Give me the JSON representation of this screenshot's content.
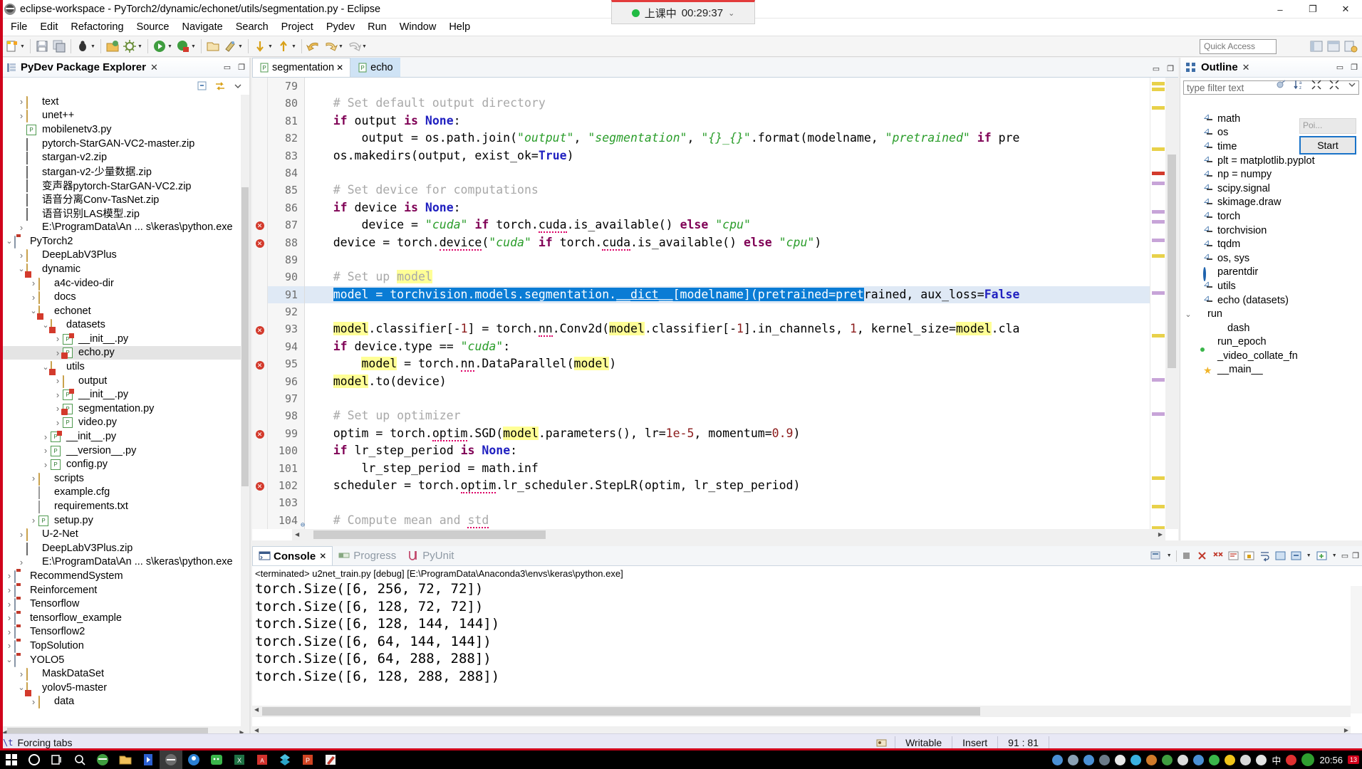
{
  "window": {
    "title": "eclipse-workspace - PyTorch2/dynamic/echonet/utils/segmentation.py - Eclipse",
    "minimize": "–",
    "maximize": "❐",
    "close": "✕"
  },
  "timer": {
    "label": "上课中",
    "time": "00:29:37",
    "caret": "⌄"
  },
  "menubar": {
    "items": [
      "File",
      "Edit",
      "Refactoring",
      "Source",
      "Navigate",
      "Search",
      "Project",
      "Pydev",
      "Run",
      "Window",
      "Help"
    ]
  },
  "toolbar": {
    "quick_access_placeholder": "Quick Access",
    "icons": [
      "new-wizard-icon",
      "save-icon",
      "save-all-icon",
      "debug-icon",
      "external-tools-icon",
      "build-icon",
      "run-icon",
      "coverage-icon",
      "open-type-icon",
      "search-icon",
      "next-annotation-icon",
      "previous-annotation-icon",
      "back-icon",
      "forward-icon",
      "undo-icon"
    ],
    "right_icons": [
      "perspective-java-icon",
      "perspective-pydev-icon",
      "open-perspective-icon"
    ]
  },
  "explorer": {
    "title": "PyDev Package Explorer",
    "close_glyph": "✕",
    "minimize_glyph": "▭",
    "maximize_glyph": "❐",
    "toolbar_icons": [
      "collapse-all-icon",
      "link-with-editor-icon",
      "view-menu-icon"
    ],
    "tree": [
      {
        "indent": 1,
        "expander": ">",
        "icon": "folder-icon",
        "label": "text"
      },
      {
        "indent": 1,
        "expander": ">",
        "icon": "folder-icon",
        "label": "unet++"
      },
      {
        "indent": 1,
        "expander": "",
        "icon": "python-file-icon",
        "label": "mobilenetv3.py"
      },
      {
        "indent": 1,
        "expander": "",
        "icon": "zip-icon",
        "label": "pytorch-StarGAN-VC2-master.zip"
      },
      {
        "indent": 1,
        "expander": "",
        "icon": "zip-icon",
        "label": "stargan-v2.zip"
      },
      {
        "indent": 1,
        "expander": "",
        "icon": "zip-icon",
        "label": "stargan-v2-少量数据.zip"
      },
      {
        "indent": 1,
        "expander": "",
        "icon": "zip-icon",
        "label": "变声器pytorch-StarGAN-VC2.zip"
      },
      {
        "indent": 1,
        "expander": "",
        "icon": "zip-icon",
        "label": "语音分离Conv-TasNet.zip"
      },
      {
        "indent": 1,
        "expander": "",
        "icon": "zip-icon",
        "label": "语音识别LAS模型.zip"
      },
      {
        "indent": 1,
        "expander": ">",
        "icon": "python-interpreter-icon",
        "label": "E:\\ProgramData\\An ... s\\keras\\python.exe"
      },
      {
        "indent": 0,
        "expander": "v",
        "icon": "project-icon",
        "label": "PyTorch2"
      },
      {
        "indent": 1,
        "expander": ">",
        "icon": "folder-icon",
        "label": "DeepLabV3Plus"
      },
      {
        "indent": 1,
        "expander": "v",
        "icon": "package-icon",
        "label": "dynamic"
      },
      {
        "indent": 2,
        "expander": ">",
        "icon": "folder-icon",
        "label": "a4c-video-dir"
      },
      {
        "indent": 2,
        "expander": ">",
        "icon": "folder-icon",
        "label": "docs"
      },
      {
        "indent": 2,
        "expander": "v",
        "icon": "package-icon",
        "label": "echonet"
      },
      {
        "indent": 3,
        "expander": "v",
        "icon": "package-icon",
        "label": "datasets"
      },
      {
        "indent": 4,
        "expander": ">",
        "icon": "init-file-icon",
        "label": "__init__.py"
      },
      {
        "indent": 4,
        "expander": ">",
        "icon": "python-error-file-icon",
        "label": "echo.py",
        "selected": true
      },
      {
        "indent": 3,
        "expander": "v",
        "icon": "package-icon",
        "label": "utils"
      },
      {
        "indent": 4,
        "expander": ">",
        "icon": "folder-icon",
        "label": "output"
      },
      {
        "indent": 4,
        "expander": ">",
        "icon": "init-file-icon",
        "label": "__init__.py"
      },
      {
        "indent": 4,
        "expander": ">",
        "icon": "python-error-file-icon",
        "label": "segmentation.py"
      },
      {
        "indent": 4,
        "expander": ">",
        "icon": "python-file-icon",
        "label": "video.py"
      },
      {
        "indent": 3,
        "expander": ">",
        "icon": "init-file-icon",
        "label": "__init__.py"
      },
      {
        "indent": 3,
        "expander": ">",
        "icon": "python-file-icon",
        "label": "__version__.py"
      },
      {
        "indent": 3,
        "expander": ">",
        "icon": "python-file-icon",
        "label": "config.py"
      },
      {
        "indent": 2,
        "expander": ">",
        "icon": "folder-icon",
        "label": "scripts"
      },
      {
        "indent": 2,
        "expander": "",
        "icon": "text-file-icon",
        "label": "example.cfg"
      },
      {
        "indent": 2,
        "expander": "",
        "icon": "text-file-icon",
        "label": "requirements.txt"
      },
      {
        "indent": 2,
        "expander": ">",
        "icon": "python-file-icon",
        "label": "setup.py"
      },
      {
        "indent": 1,
        "expander": ">",
        "icon": "folder-icon",
        "label": "U-2-Net"
      },
      {
        "indent": 1,
        "expander": "",
        "icon": "zip-icon",
        "label": "DeepLabV3Plus.zip"
      },
      {
        "indent": 1,
        "expander": ">",
        "icon": "python-interpreter-icon",
        "label": "E:\\ProgramData\\An ... s\\keras\\python.exe"
      },
      {
        "indent": 0,
        "expander": ">",
        "icon": "project-icon",
        "label": "RecommendSystem"
      },
      {
        "indent": 0,
        "expander": ">",
        "icon": "project-icon",
        "label": "Reinforcement"
      },
      {
        "indent": 0,
        "expander": ">",
        "icon": "project-icon",
        "label": "Tensorflow"
      },
      {
        "indent": 0,
        "expander": ">",
        "icon": "project-icon",
        "label": "tensorflow_example"
      },
      {
        "indent": 0,
        "expander": ">",
        "icon": "project-icon",
        "label": "Tensorflow2"
      },
      {
        "indent": 0,
        "expander": ">",
        "icon": "project-icon",
        "label": "TopSolution"
      },
      {
        "indent": 0,
        "expander": "v",
        "icon": "project-icon",
        "label": "YOLO5"
      },
      {
        "indent": 1,
        "expander": ">",
        "icon": "folder-icon",
        "label": "MaskDataSet"
      },
      {
        "indent": 1,
        "expander": "v",
        "icon": "package-icon",
        "label": "yolov5-master"
      },
      {
        "indent": 2,
        "expander": ">",
        "icon": "folder-icon",
        "label": "data"
      }
    ]
  },
  "editor": {
    "tabs": [
      {
        "label": "segmentation",
        "active": true,
        "close_glyph": "✕",
        "icon": "python-file-icon"
      },
      {
        "label": "echo",
        "active": false,
        "close_glyph": "",
        "icon": "python-file-icon"
      }
    ],
    "controls": [
      "minimize-icon",
      "maximize-icon"
    ],
    "lines": [
      {
        "n": "79",
        "err": false,
        "html": ""
      },
      {
        "n": "80",
        "err": false,
        "html": "<span class='cmt'>    # Set default output directory</span>"
      },
      {
        "n": "81",
        "err": false,
        "html": "    <span class='kw'>if</span> output <span class='kw'>is</span> <span class='kw2'>None</span>:"
      },
      {
        "n": "82",
        "err": false,
        "html": "        output = os.path.join(<span class='str'>\"output\"</span>, <span class='str'>\"segmentation\"</span>, <span class='str'>\"{}_{}\"</span>.format(modelname, <span class='str'>\"pretrained\"</span> <span class='kw'>if</span> pre"
      },
      {
        "n": "83",
        "err": false,
        "html": "    os.makedirs(output, exist_ok=<span class='kw2'>True</span>)"
      },
      {
        "n": "84",
        "err": false,
        "html": ""
      },
      {
        "n": "85",
        "err": false,
        "html": "<span class='cmt'>    # Set device for computations</span>"
      },
      {
        "n": "86",
        "err": false,
        "html": "    <span class='kw'>if</span> device <span class='kw'>is</span> <span class='kw2'>None</span>:"
      },
      {
        "n": "87",
        "err": true,
        "html": "        device = <span class='str'>\"cuda\"</span> <span class='kw'>if</span> torch.<span class='sq'>cuda</span>.is_available() <span class='kw'>else</span> <span class='str'>\"cpu\"</span>"
      },
      {
        "n": "88",
        "err": true,
        "html": "    device = torch.<span class='sq'>device</span>(<span class='str'>\"cuda\"</span> <span class='kw'>if</span> torch.<span class='sq'>cuda</span>.is_available() <span class='kw'>else</span> <span class='str'>\"cpu\"</span>)"
      },
      {
        "n": "89",
        "err": false,
        "html": ""
      },
      {
        "n": "90",
        "err": false,
        "html": "<span class='cmt'>    # Set up <span class='hl'>model</span></span>"
      },
      {
        "n": "91",
        "err": false,
        "selected": true,
        "html": "    <span class='selcode'>model = torchvision.models.segmentation.<span class='ul'>__dict__</span>[modelname](pretrained=pret</span>rained, aux_loss=<span class='kw2'>False</span>"
      },
      {
        "n": "92",
        "err": false,
        "html": ""
      },
      {
        "n": "93",
        "err": true,
        "html": "    <span class='hl'>model</span>.classifier[-<span class='num'>1</span>] = torch.<span class='sq'>nn</span>.Conv2d(<span class='hl'>model</span>.classifier[-<span class='num'>1</span>].in_channels, <span class='num'>1</span>, kernel_size=<span class='hl'>model</span>.cla"
      },
      {
        "n": "94",
        "err": false,
        "html": "    <span class='kw'>if</span> device.type == <span class='str'>\"cuda\"</span>:"
      },
      {
        "n": "95",
        "err": true,
        "html": "        <span class='hl'>model</span> = torch.<span class='sq'>nn</span>.DataParallel(<span class='hl'>model</span>)"
      },
      {
        "n": "96",
        "err": false,
        "html": "    <span class='hl'>model</span>.to(device)"
      },
      {
        "n": "97",
        "err": false,
        "html": ""
      },
      {
        "n": "98",
        "err": false,
        "html": "<span class='cmt'>    # Set up optimizer</span>"
      },
      {
        "n": "99",
        "err": true,
        "html": "    optim = torch.<span class='sq'>optim</span>.SGD(<span class='hl'>model</span>.parameters(), lr=<span class='num'>1e-5</span>, momentum=<span class='num'>0.9</span>)"
      },
      {
        "n": "100",
        "err": false,
        "html": "    <span class='kw'>if</span> lr_step_period <span class='kw'>is</span> <span class='kw2'>None</span>:"
      },
      {
        "n": "101",
        "err": false,
        "html": "        lr_step_period = math.inf"
      },
      {
        "n": "102",
        "err": true,
        "html": "    scheduler = torch.<span class='sq'>optim</span>.lr_scheduler.StepLR(optim, lr_step_period)"
      },
      {
        "n": "103",
        "err": false,
        "html": ""
      },
      {
        "n": "104",
        "err": false,
        "fold": true,
        "html": "<span class='cmt'>    # Compute mean and <span class='sq'>std</span></span>"
      }
    ]
  },
  "outline": {
    "title": "Outline",
    "close_glyph": "✕",
    "minimize_glyph": "▭",
    "maximize_glyph": "❐",
    "filter_placeholder": "type filter text",
    "toolbar_icons": [
      "link-icon",
      "sort-icon",
      "collapse-all-icon",
      "expand-all-icon",
      "view-menu-icon"
    ],
    "items": [
      {
        "indent": 1,
        "expander": "",
        "icon": "import-icon",
        "label": "math"
      },
      {
        "indent": 1,
        "expander": "",
        "icon": "import-icon",
        "label": "os"
      },
      {
        "indent": 1,
        "expander": "",
        "icon": "import-icon",
        "label": "time"
      },
      {
        "indent": 1,
        "expander": "",
        "icon": "import-icon",
        "label": "plt = matplotlib.pyplot"
      },
      {
        "indent": 1,
        "expander": "",
        "icon": "import-icon",
        "label": "np = numpy"
      },
      {
        "indent": 1,
        "expander": "",
        "icon": "import-icon",
        "label": "scipy.signal"
      },
      {
        "indent": 1,
        "expander": "",
        "icon": "import-icon",
        "label": "skimage.draw"
      },
      {
        "indent": 1,
        "expander": "",
        "icon": "import-icon",
        "label": "torch"
      },
      {
        "indent": 1,
        "expander": "",
        "icon": "import-icon",
        "label": "torchvision"
      },
      {
        "indent": 1,
        "expander": "",
        "icon": "import-icon",
        "label": "tqdm"
      },
      {
        "indent": 1,
        "expander": "",
        "icon": "import-icon",
        "label": "os, sys"
      },
      {
        "indent": 1,
        "expander": "",
        "icon": "variable-icon",
        "label": "parentdir"
      },
      {
        "indent": 1,
        "expander": "",
        "icon": "import-icon",
        "label": "utils"
      },
      {
        "indent": 1,
        "expander": "",
        "icon": "import-icon",
        "label": "echo (datasets)"
      },
      {
        "indent": 0,
        "expander": "v",
        "icon": "method-icon",
        "label": "run"
      },
      {
        "indent": 2,
        "expander": "",
        "icon": "method-icon",
        "label": "dash"
      },
      {
        "indent": 1,
        "expander": "",
        "icon": "method-icon",
        "label": "run_epoch"
      },
      {
        "indent": 1,
        "expander": "",
        "icon": "method-private-icon",
        "label": "_video_collate_fn"
      },
      {
        "indent": 1,
        "expander": "",
        "icon": "main-icon",
        "label": "__main__"
      }
    ],
    "popup": {
      "field_text": "Poi...",
      "button_label": "Start"
    }
  },
  "console": {
    "tabs": [
      {
        "label": "Console",
        "active": true,
        "close_glyph": "✕",
        "icon": "console-icon"
      },
      {
        "label": "Progress",
        "active": false,
        "icon": "progress-icon"
      },
      {
        "label": "PyUnit",
        "active": false,
        "icon": "pyunit-icon"
      }
    ],
    "toolbar_icons": [
      "display-selected-console-icon",
      "terminate-icon",
      "remove-launch-icon",
      "remove-all-icon",
      "clear-icon",
      "scroll-lock-icon",
      "word-wrap-icon",
      "pin-console-icon",
      "open-console-icon",
      "new-console-view-icon",
      "minimize-icon",
      "maximize-icon"
    ],
    "launch_line": "<terminated> u2net_train.py [debug] [E:\\ProgramData\\Anaconda3\\envs\\keras\\python.exe]",
    "output": [
      "torch.Size([6, 256, 72, 72])",
      "torch.Size([6, 128, 72, 72])",
      "torch.Size([6, 128, 144, 144])",
      "torch.Size([6, 64, 144, 144])",
      "torch.Size([6, 64, 288, 288])",
      "torch.Size([6, 128, 288, 288])"
    ],
    "prompt": ">>>"
  },
  "statusbar": {
    "vt_glyph": "\\t",
    "message": "Forcing tabs",
    "smart_insert_icon": "smart-insert-icon",
    "writable": "Writable",
    "insert": "Insert",
    "position": "91 : 81"
  },
  "taskbar": {
    "start_icon": "windows-start-icon",
    "left_icons": [
      "cortana-icon",
      "task-view-icon",
      "search-icon",
      "eclipse-icon",
      "file-explorer-icon",
      "editor-icon",
      "eclipse-active-icon",
      "browser-icon",
      "wechat-icon",
      "excel-icon",
      "pdf-icon",
      "sublime-icon",
      "powerpoint-icon",
      "paint-icon"
    ],
    "tray_icons": [
      "shield-icon",
      "network-icon",
      "security-icon",
      "settings-icon",
      "bell-icon",
      "sync-icon",
      "snail-icon",
      "eclipse-tray-icon",
      "usb-icon",
      "box-icon",
      "green-shield-icon",
      "plus-icon",
      "display-icon",
      "volume-icon"
    ],
    "ime": "中",
    "clock": "20:56",
    "notification_count": "13"
  },
  "colors": {
    "accent": "#0a7cd5",
    "error": "#d33a2c",
    "highlight": "#ffff96",
    "comment": "#a8a8a8",
    "string": "#2a9d2a",
    "keyword": "#7f0055",
    "statusbar_bg": "#e8e8f5",
    "red_border": "#d0021b"
  }
}
